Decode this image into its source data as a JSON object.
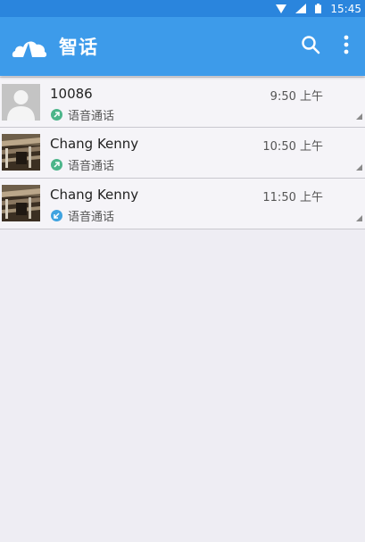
{
  "status_bar": {
    "time": "15:45",
    "icons": [
      "wifi-icon",
      "signal-icon",
      "battery-icon"
    ]
  },
  "app_bar": {
    "title": "智话",
    "logo": "cloud-logo",
    "actions": [
      "search-icon",
      "more-vert-icon"
    ],
    "colors": {
      "primary": "#3d9bea",
      "status": "#2a85dd"
    }
  },
  "calls": [
    {
      "name": "10086",
      "time": "9:50 上午",
      "type": "语音通话",
      "direction": "outgoing",
      "avatar": "default-avatar"
    },
    {
      "name": "Chang Kenny",
      "time": "10:50 上午",
      "type": "语音通话",
      "direction": "outgoing",
      "avatar": "photo-avatar"
    },
    {
      "name": "Chang Kenny",
      "time": "11:50 上午",
      "type": "语音通话",
      "direction": "incoming",
      "avatar": "photo-avatar"
    }
  ],
  "colors": {
    "outgoing": "#4cb58a",
    "incoming": "#3fa3e0"
  }
}
